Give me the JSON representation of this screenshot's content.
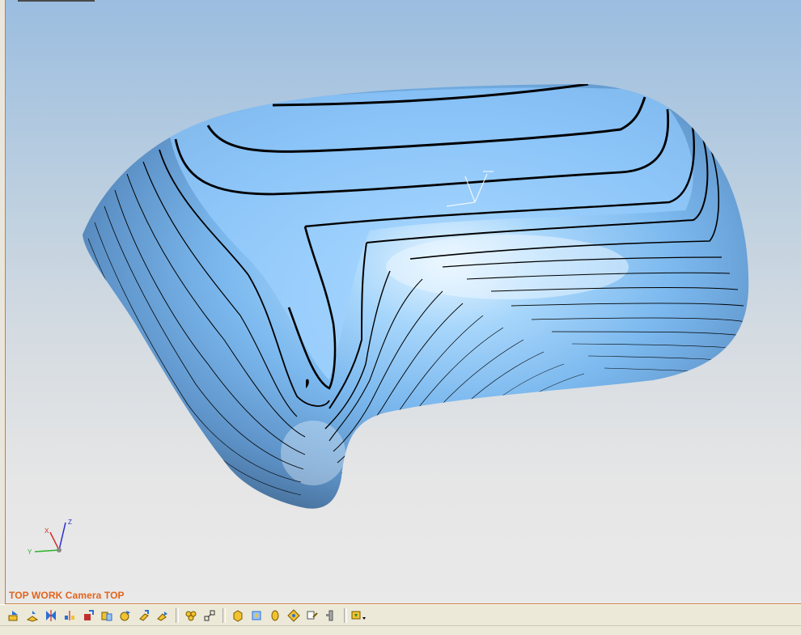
{
  "viewport": {
    "view_label": "TOP WORK Camera TOP",
    "triad": {
      "x_label": "X",
      "y_label": "Y",
      "z_label": "Z"
    },
    "model_color": "#77b6f0",
    "contour_color": "#000000"
  },
  "colors": {
    "background_top": "#9bbde0",
    "background_bottom": "#e9e9e9",
    "frame_accent": "#c77d3a",
    "label_orange": "#e3641c"
  },
  "toolbar": {
    "groups": [
      [
        "view-top-icon",
        "view-iso-icon",
        "section-icon",
        "mirror-icon",
        "transform-icon",
        "copy-icon",
        "offset-icon",
        "extrude-icon",
        "move-icon"
      ],
      [
        "group-icon",
        "ungroup-icon"
      ],
      [
        "solid-box-icon",
        "solid-cut-icon",
        "surface-icon",
        "shade-icon",
        "edit-icon",
        "tool-icon"
      ],
      [
        "dropdown-icon"
      ]
    ]
  }
}
